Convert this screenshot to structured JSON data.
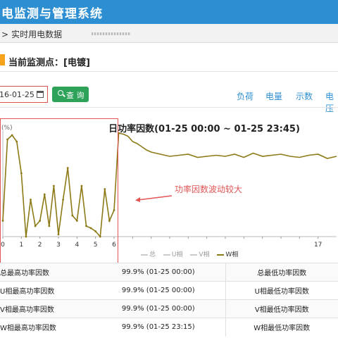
{
  "app": {
    "title": "电监测与管理系统"
  },
  "breadcrumb": {
    "sep": ">",
    "current": "实时用电数据"
  },
  "monitor": {
    "label": "当前监测点：[电镀]"
  },
  "toolbar": {
    "date_value": "16-01-25",
    "query_label": "查 询",
    "tabs": [
      "负荷",
      "电量",
      "示数",
      "电压"
    ]
  },
  "chart_data": {
    "type": "line",
    "title": "日功率因数(01-25 00:00 ~ 01-25 23:45)",
    "ylabel": "(%)",
    "x_ticks": [
      0,
      1,
      2,
      3,
      4,
      5,
      6,
      7,
      8,
      9,
      10,
      11,
      12,
      13,
      14,
      15,
      16,
      17
    ],
    "x_tick_labels": [
      "0",
      "1",
      "2",
      "3",
      "4",
      "5",
      "6",
      "",
      "",
      "",
      "",
      "",
      "",
      "",
      "",
      "",
      "",
      "17"
    ],
    "xlim": [
      0,
      18
    ],
    "ylim": [
      0,
      100
    ],
    "legend": [
      "总",
      "U相",
      "V相",
      "W相"
    ],
    "series": [
      {
        "name": "W相",
        "color": "#8c7a17",
        "x": [
          0,
          0.25,
          0.5,
          0.75,
          1,
          1.25,
          1.5,
          1.75,
          2,
          2.25,
          2.5,
          2.75,
          3,
          3.25,
          3.5,
          3.75,
          4,
          4.25,
          4.5,
          4.75,
          5,
          5.25,
          5.5,
          5.75,
          6,
          6.25,
          6.5,
          6.75,
          7,
          7.25,
          7.5,
          7.75,
          8,
          8.5,
          9,
          9.5,
          10,
          10.5,
          11,
          11.5,
          12,
          12.5,
          13,
          13.5,
          14,
          14.5,
          15,
          15.5,
          16,
          16.5,
          17,
          17.5,
          18
        ],
        "values": [
          15,
          92,
          96,
          90,
          60,
          0,
          35,
          10,
          15,
          40,
          10,
          48,
          2,
          35,
          65,
          20,
          15,
          48,
          10,
          8,
          5,
          0,
          45,
          15,
          25,
          98,
          97,
          95,
          90,
          88,
          85,
          82,
          80,
          78,
          76,
          77,
          78,
          75,
          76,
          77,
          76,
          78,
          75,
          79,
          76,
          77,
          78,
          76,
          75,
          77,
          78,
          74,
          76
        ]
      }
    ],
    "annotation": "功率因数波动较大"
  },
  "summary": [
    {
      "name": "总最高功率因数",
      "value": "99.9%) (01-25 00:00)",
      "name2": "总最低功率因数"
    },
    {
      "name": "U相最高功率因数",
      "value": "99.9%) (01-25 00:00)",
      "name2": "U相最低功率因数"
    },
    {
      "name": "V相最高功率因数",
      "value": "99.9%) (01-25 00:00)",
      "name2": "V相最低功率因数"
    },
    {
      "name": "W相最高功率因数",
      "value": "99.9%) (01-25 23:15)",
      "name2": "W相最低功率因数"
    }
  ],
  "summary_prefix": "99.9% (01-25 00:00)"
}
